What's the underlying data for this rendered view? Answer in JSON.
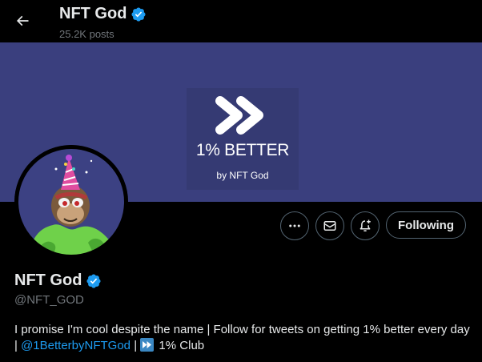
{
  "header": {
    "name": "NFT God",
    "posts": "25.2K posts"
  },
  "banner": {
    "title": "1% BETTER",
    "subtitle": "by NFT God",
    "background_color": "#3a3f7e",
    "tile_color": "#353a73"
  },
  "actions": {
    "more_icon": "more-icon",
    "message_icon": "envelope-icon",
    "notify_icon": "bell-plus-icon",
    "following_label": "Following"
  },
  "profile": {
    "name": "NFT God",
    "handle": "@NFT_GOD",
    "bio_text": "I promise I'm cool despite the name | Follow for tweets on getting 1% better every day | ",
    "bio_link": "@1BetterbyNFTGod",
    "bio_separator": " | ",
    "bio_club": " 1% Club"
  },
  "colors": {
    "verified": "#1d9bf0",
    "link": "#1d9bf0",
    "muted_text": "#71767b"
  }
}
